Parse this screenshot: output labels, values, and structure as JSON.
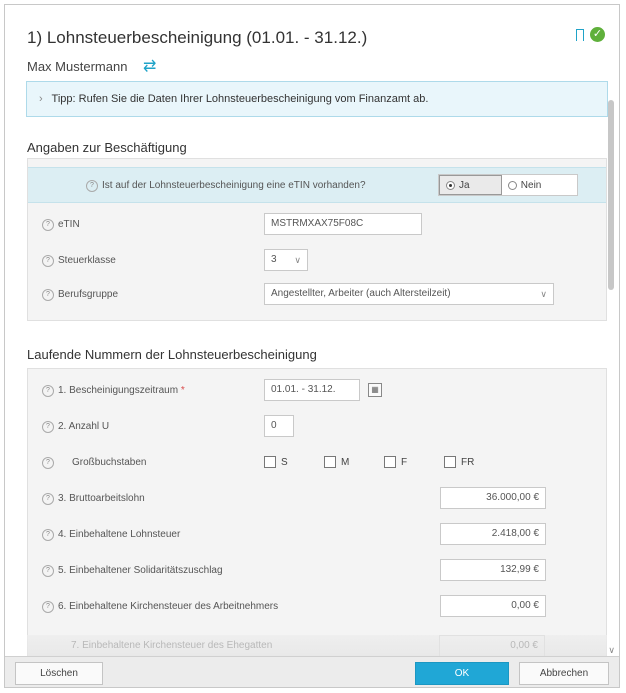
{
  "header": {
    "title": "1) Lohnsteuerbescheinigung (01.01. - 31.12.)",
    "person": "Max Mustermann",
    "icons": {
      "bookmark": "bookmark-icon",
      "status": "check-circle-icon",
      "swap": "swap-arrows-icon"
    },
    "status_glyph": "✓",
    "swap_glyph": "⇄"
  },
  "tip": {
    "chevron": "›",
    "text": "Tipp: Rufen Sie die Daten Ihrer Lohnsteuerbescheinigung vom Finanzamt ab."
  },
  "beschaeftigung": {
    "heading": "Angaben zur Beschäftigung",
    "etin_question": "Ist auf der Lohnsteuerbescheinigung eine eTIN vorhanden?",
    "radio_yes": "Ja",
    "radio_no": "Nein",
    "selected": "Ja",
    "etin_label": "eTIN",
    "etin_value": "MSTRMXAX75F08C",
    "steuerklasse_label": "Steuerklasse",
    "steuerklasse_value": "3",
    "berufsgruppe_label": "Berufsgruppe",
    "berufsgruppe_value": "Angestellter, Arbeiter (auch Altersteilzeit)"
  },
  "lfd": {
    "heading": "Laufende Nummern der Lohnsteuerbescheinigung",
    "zeitraum_label": "1. Bescheinigungszeitraum",
    "required_mark": "*",
    "zeitraum_value": "01.01. - 31.12.",
    "anzahl_label": "2. Anzahl U",
    "anzahl_value": "0",
    "gross_label": "Großbuchstaben",
    "letters": [
      "S",
      "M",
      "F",
      "FR"
    ],
    "brutto_label": "3. Bruttoarbeitslohn",
    "brutto_value": "36.000,00 €",
    "lohnsteuer_label": "4. Einbehaltene Lohnsteuer",
    "lohnsteuer_value": "2.418,00 €",
    "soli_label": "5. Einbehaltener Solidaritätszuschlag",
    "soli_value": "132,99 €",
    "kirche_label": "6. Einbehaltene Kirchensteuer des Arbeitnehmers",
    "kirche_value": "0,00 €",
    "kirche_ehe_label": "7. Einbehaltene Kirchensteuer des Ehegatten",
    "kirche_ehe_value": "0,00 €"
  },
  "footer": {
    "delete": "Löschen",
    "ok": "OK",
    "cancel": "Abbrechen"
  },
  "colors": {
    "accent": "#20a7d6",
    "success": "#5fb03b",
    "highlight_row": "#dceef3"
  }
}
